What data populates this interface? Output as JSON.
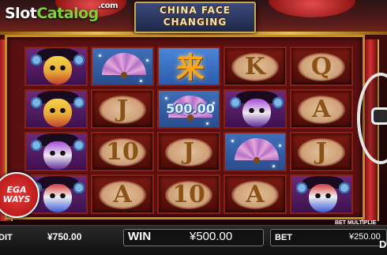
{
  "watermark": {
    "brand_a": "Slot",
    "brand_b": "Catalog",
    "suffix": ".com"
  },
  "game": {
    "title_line1": "CHINA FACE",
    "title_line2": "CHANGING"
  },
  "reels": [
    [
      "mask-yellow",
      "mask-yellow",
      "mask-purple",
      "mask-redblue"
    ],
    [
      "fan",
      "J",
      "10",
      "A"
    ],
    [
      "wild",
      "fan",
      "J",
      "10"
    ],
    [
      "K",
      "mask-purple",
      "fan",
      "A"
    ],
    [
      "Q",
      "A",
      "J",
      "mask-redblue"
    ]
  ],
  "symbols": {
    "wild_glyph": "来"
  },
  "win_overlay": {
    "amount": "500.00"
  },
  "badge": {
    "line1": "EGA",
    "line2": "WAYS"
  },
  "bottom_bar": {
    "credit_label": "DIT",
    "credit_value": "¥750.00",
    "win_label": "WIN",
    "win_value": "¥500.00",
    "bet_label": "BET",
    "bet_value": "¥250.00",
    "bet_multiplier_label": "BET MULTIPLIE",
    "cut_label": "D"
  },
  "icons": {
    "spin": "spin-button-icon"
  },
  "colors": {
    "frame_gold": "#c28a2a",
    "reel_red": "#5a1010",
    "wild_blue": "#4a86d8",
    "badge_red": "#e93a3a"
  }
}
